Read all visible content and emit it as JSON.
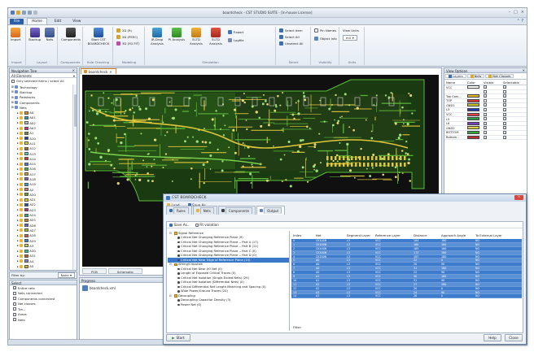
{
  "window": {
    "title": "boardcheck - CST STUDIO SUITE - [In-house License]"
  },
  "quick_access": [
    "save-icon",
    "open-icon",
    "undo-icon",
    "redo-icon",
    "customize-icon"
  ],
  "menu_tabs": [
    "File",
    "Home",
    "Edit",
    "View"
  ],
  "ribbon": {
    "groups": [
      {
        "label": "Import",
        "buttons": [
          "Import"
        ]
      },
      {
        "label": "Layout",
        "buttons": [
          "Stackup",
          "Nets"
        ]
      },
      {
        "label": "Components",
        "buttons": [
          "Components"
        ]
      },
      {
        "label": "Rule Checking",
        "buttons": [
          "Start CST BOARDCHECK"
        ]
      },
      {
        "label": "Modeling",
        "buttons": [
          "2D (R)",
          "2D (PEEC)",
          "3D (FD FIT)"
        ]
      },
      {
        "label": "Simulation",
        "buttons": [
          "IR-Drop Analysis",
          "PI Analysis",
          "SI-TD Analysis",
          "SI-TD Analysis",
          "Export",
          "Logfile"
        ]
      },
      {
        "label": "Select",
        "buttons": [
          "Select Item",
          "Select All",
          "Unselect All",
          "Object Info"
        ]
      },
      {
        "label": "Visibility",
        "buttons": [
          "Pin Names"
        ]
      },
      {
        "label": "Units",
        "buttons": [
          "View Units",
          "mil"
        ]
      }
    ]
  },
  "nav_tree": {
    "title": "Navigation Tree",
    "selector": "All Elements",
    "checkbox_label": "Only selected items / select All",
    "items": [
      "Technology",
      "Stackup",
      "Padstacks",
      "Components",
      "Nets",
      "A0",
      "A01",
      "A02",
      "A03",
      "A1",
      "A10",
      "A11",
      "A12",
      "A13",
      "A14",
      "A15",
      "A16",
      "A17",
      "A18",
      "A19",
      "A2",
      "A20",
      "A21",
      "A22",
      "A23",
      "A24",
      "A25",
      "A26",
      "A27",
      "A28",
      "A29",
      "A3",
      "A30",
      "A31",
      "A4",
      "A5",
      "A6",
      "A7",
      "A8",
      "A9"
    ],
    "swatches": [
      "#e6c61c",
      "#d8472b",
      "#2f6fd6",
      "#2bb14a",
      "#8e44c9",
      "#f08b1d",
      "#17a3b8",
      "#c0c0c0",
      "#d62e7e",
      "#6a8f2a",
      "#1f3fa8",
      "#e0e020",
      "#b5651d",
      "#4ad0c0",
      "#e03030",
      "#5070e0",
      "#50b050",
      "#d0a030",
      "#9050d0",
      "#30a0d0",
      "#e07070",
      "#70a030",
      "#f0d020",
      "#2050b0",
      "#c03080",
      "#20b080",
      "#d08020",
      "#6060d0",
      "#a0c020",
      "#e05050",
      "#3080e0",
      "#d0d040",
      "#40c0a0",
      "#c06020",
      "#8080e0",
      "#e0b030",
      "#3aa050",
      "#b040a0",
      "#2f8fd0",
      "#d9c21e"
    ]
  },
  "filter": {
    "label": "Filter by:",
    "value": "None"
  },
  "select_panel": {
    "title": "Select",
    "items": [
      "Entire nets",
      "Nets connected",
      "Components connected",
      "Net classes",
      "Tra...",
      "Areas",
      "Nets"
    ]
  },
  "document": {
    "tab": "boardcheck",
    "view_tabs": [
      "PCB",
      "Schematic"
    ]
  },
  "progress": {
    "title": "Progress",
    "item": "boardcheck.xml",
    "tabs": [
      "Messages",
      "Progress"
    ]
  },
  "view_options": {
    "title": "View Options",
    "tabs": [
      "Layers",
      "Nets",
      "Net Classes"
    ],
    "columns": [
      "Name",
      "Color",
      "Visible",
      "Selectable"
    ],
    "layers": [
      {
        "name": "VCC",
        "color": "#ffffff",
        "visible": true,
        "selectable": true
      },
      {
        "name": "",
        "color": "",
        "visible": false,
        "selectable": false
      },
      {
        "name": "Top Com...",
        "color": "#e4b822",
        "visible": true,
        "selectable": true
      },
      {
        "name": "TOP",
        "color": "#d73a2e",
        "visible": false,
        "selectable": true
      },
      {
        "name": "GND1",
        "color": "#c8c020",
        "visible": true,
        "selectable": true
      },
      {
        "name": "L3",
        "color": "#1f3fb8",
        "visible": true,
        "selectable": true
      },
      {
        "name": "VCC",
        "color": "#e04040",
        "visible": true,
        "selectable": true
      },
      {
        "name": "L5",
        "color": "#2aa040",
        "visible": true,
        "selectable": true
      },
      {
        "name": "L6",
        "color": "#7a3fc0",
        "visible": true,
        "selectable": true
      },
      {
        "name": "GND2",
        "color": "#e0d040",
        "visible": true,
        "selectable": true
      },
      {
        "name": "BOTTOM",
        "color": "#2faa3a",
        "visible": true,
        "selectable": true
      },
      {
        "name": "Bottom...",
        "color": "#c03030",
        "visible": true,
        "selectable": true
      }
    ]
  },
  "dialog": {
    "title": "CST BOARDCHECK",
    "toolbar": [
      "Load...",
      "Save As..."
    ],
    "tabs": [
      "Rules",
      "Nets",
      "Components",
      "Output"
    ],
    "inner_toolbar": [
      "Save As...",
      "Fit violation"
    ],
    "tree": [
      {
        "level": 0,
        "text": "Signal Reference",
        "folder": true
      },
      {
        "level": 1,
        "text": "Critical Net Changing Reference Plane (9)"
      },
      {
        "level": 1,
        "text": "Critical Net Changing Reference Plane -- Part A (17)"
      },
      {
        "level": 1,
        "text": "Critical Net Changing Reference Plane -- Part B (11)"
      },
      {
        "level": 1,
        "text": "Critical Net Changing Reference Plane -- Part C (0)"
      },
      {
        "level": 1,
        "text": "Critical Net Changing Reference Plane -- Part D (0)"
      },
      {
        "level": 1,
        "text": "Critical Net Near Edge of Reference Plane (15)",
        "selected": true
      },
      {
        "level": 0,
        "text": "Wiring/Crosstalk",
        "folder": true
      },
      {
        "level": 1,
        "text": "Critical Net Near I/O Net (0)"
      },
      {
        "level": 1,
        "text": "Length of Exposed Critical Traces (0)"
      },
      {
        "level": 1,
        "text": "Critical Net Isolation (Single-Ended Nets) (29)"
      },
      {
        "level": 1,
        "text": "Critical Net Isolation (Differential Nets) (0)"
      },
      {
        "level": 1,
        "text": "Critical Differential Net Length Matching and Spacing (0)"
      },
      {
        "level": 1,
        "text": "Wide Power/Ground Traces (20)"
      },
      {
        "level": 0,
        "text": "Decoupling",
        "folder": true
      },
      {
        "level": 1,
        "text": "Decoupling Capacitor Density (3)"
      },
      {
        "level": 1,
        "text": "Power Net (0)"
      }
    ],
    "table_columns": [
      "Index",
      "Net",
      "Segment Layer",
      "Reference Layer",
      "Distance",
      "Approach Angle",
      "To External Layer"
    ],
    "rows": [
      [
        "0",
        "CK100N",
        "L3",
        "VCC",
        "184",
        "180",
        "NO"
      ],
      [
        "1",
        "CK100N",
        "L3",
        "VCC",
        "160",
        "180",
        "NO"
      ],
      [
        "2",
        "CK100N",
        "L3",
        "VCC",
        "165",
        "180",
        "NO"
      ],
      [
        "3",
        "CK100N",
        "L3",
        "VCC",
        "172",
        "180",
        "NO"
      ],
      [
        "4",
        "CK100N",
        "L3",
        "VCC",
        "187",
        "180",
        "NO"
      ],
      [
        "5",
        "A0",
        "L3",
        "VCC",
        "22",
        "0",
        "NO"
      ],
      [
        "6",
        "A0",
        "L3",
        "VCC",
        "20",
        "90",
        "NO"
      ],
      [
        "7",
        "A0",
        "L3",
        "VCC",
        "31",
        "180",
        "NO"
      ],
      [
        "8",
        "A0",
        "L3",
        "VCC",
        "22",
        "90",
        "NO"
      ],
      [
        "9",
        "A1",
        "L3",
        "VCC",
        "30",
        "180",
        "NO"
      ],
      [
        "10",
        "A1",
        "L3",
        "VCC",
        "21",
        "90",
        "NO"
      ],
      [
        "11",
        "A2",
        "L3",
        "VCC",
        "27",
        "180",
        "NO"
      ],
      [
        "12",
        "A2",
        "L3",
        "VCC",
        "20",
        "0",
        "NO"
      ],
      [
        "13",
        "A3",
        "L3",
        "VCC",
        "24",
        "90",
        "NO"
      ],
      [
        "14",
        "A3",
        "L3",
        "VCC",
        "28",
        "0",
        "NO"
      ]
    ],
    "filter_label": "Filter:",
    "footer": {
      "start": "Start",
      "help": "Help",
      "close": "Close"
    }
  },
  "colors": {
    "accent": "#2a5ea8",
    "selection": "#3d7ccc",
    "pcb_bg": "#101010",
    "trace_green": "#5fbf3a",
    "trace_yellow": "#e0c63a"
  }
}
